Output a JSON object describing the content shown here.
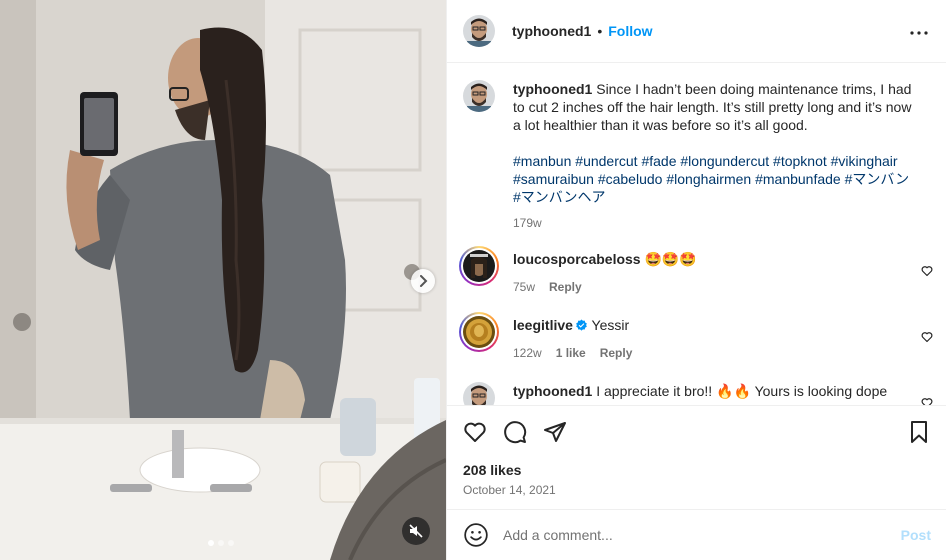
{
  "post": {
    "username": "typhooned1",
    "follow_label": "Follow",
    "separator": "•",
    "caption_username": "typhooned1",
    "caption_text": " Since I hadn’t been doing maintenance trims, I had to cut 2 inches off the hair length. It’s still pretty long and it’s now a lot healthier than it was before so it’s all good.",
    "hashtags": [
      "#manbun",
      "#undercut",
      "#fade",
      "#longundercut",
      "#topknot",
      "#vikinghair",
      "#samuraibun",
      "#cabeludo",
      "#longhairmen",
      "#manbunfade",
      "#マンバン",
      "#マンバンヘア"
    ],
    "caption_age": "179w",
    "likes": "208 likes",
    "date": "October 14, 2021",
    "carousel": {
      "slides": 3,
      "active": 1
    }
  },
  "comments": [
    {
      "username": "loucosporcabeloss",
      "text": " 🤩🤩🤩",
      "age": "75w",
      "likes": "",
      "reply": "Reply"
    },
    {
      "username": "leegitlive",
      "text": " Yessir",
      "age": "122w",
      "likes": "1 like",
      "reply": "Reply",
      "verified": true
    },
    {
      "username": "typhooned1",
      "text": " I appreciate it bro!! 🔥🔥 Yours is looking dope",
      "age": "",
      "likes": "",
      "reply": ""
    }
  ],
  "composer": {
    "placeholder": "Add a comment...",
    "post_label": "Post"
  },
  "icons": {
    "more": "more-horizontal-icon",
    "like": "heart-icon",
    "comment": "comment-icon",
    "share": "paper-plane-icon",
    "save": "bookmark-icon",
    "emoji": "smiley-icon",
    "next": "chevron-right-icon",
    "mute": "speaker-muted-icon"
  },
  "colors": {
    "accent": "#0095f6",
    "hashtag": "#00376b",
    "muted_text": "#737373",
    "post_disabled": "#b2dffc"
  }
}
